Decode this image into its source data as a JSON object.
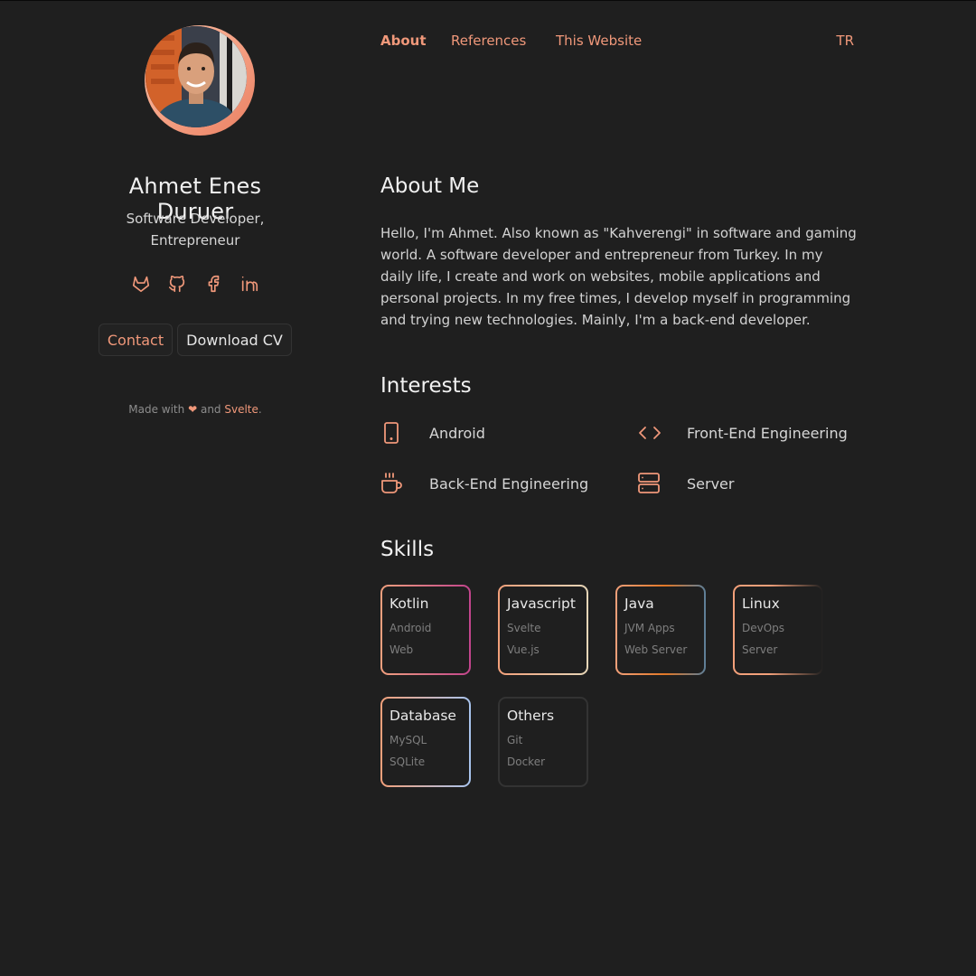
{
  "profile": {
    "name": "Ahmet Enes Duruer",
    "role_line1": "Software Developer,",
    "role_line2": "Entrepreneur"
  },
  "socials": [
    "gitlab-icon",
    "github-icon",
    "facebook-icon",
    "linkedin-icon"
  ],
  "buttons": {
    "contact": "Contact",
    "download_cv": "Download CV"
  },
  "footer": {
    "made_with": "Made with",
    "heart": "❤",
    "and": "and",
    "svelte": "Svelte",
    "period": "."
  },
  "nav": {
    "items": [
      {
        "label": "About",
        "active": true
      },
      {
        "label": "References"
      },
      {
        "label": "This Website"
      }
    ],
    "lang": "TR"
  },
  "about": {
    "title": "About Me",
    "text": "Hello, I'm Ahmet. Also known as \"Kahverengi\" in software and gaming world. A software developer and entrepreneur from Turkey. In my daily life, I create and work on websites, mobile applications and personal projects. In my free times, I develop myself in programming and trying new technologies. Mainly, I'm a back-end developer."
  },
  "interests": {
    "title": "Interests",
    "items": [
      {
        "label": "Android",
        "icon": "phone-icon"
      },
      {
        "label": "Front-End Engineering",
        "icon": "code-icon"
      },
      {
        "label": "Back-End Engineering",
        "icon": "coffee-cup-icon"
      },
      {
        "label": "Server",
        "icon": "server-icon"
      }
    ]
  },
  "skills": {
    "title": "Skills",
    "items": [
      {
        "title": "Kotlin",
        "sub": [
          "Android",
          "Web"
        ]
      },
      {
        "title": "Javascript",
        "sub": [
          "Svelte",
          "Vue.js"
        ]
      },
      {
        "title": "Java",
        "sub": [
          "JVM Apps",
          "Web Server"
        ]
      },
      {
        "title": "Linux",
        "sub": [
          "DevOps",
          "Server"
        ]
      },
      {
        "title": "Database",
        "sub": [
          "MySQL",
          "SQLite"
        ]
      },
      {
        "title": "Others",
        "sub": [
          "Git",
          "Docker"
        ]
      }
    ]
  },
  "colors": {
    "accent": "#f0987a",
    "background": "#1f1f1f",
    "text": "#dedede"
  }
}
